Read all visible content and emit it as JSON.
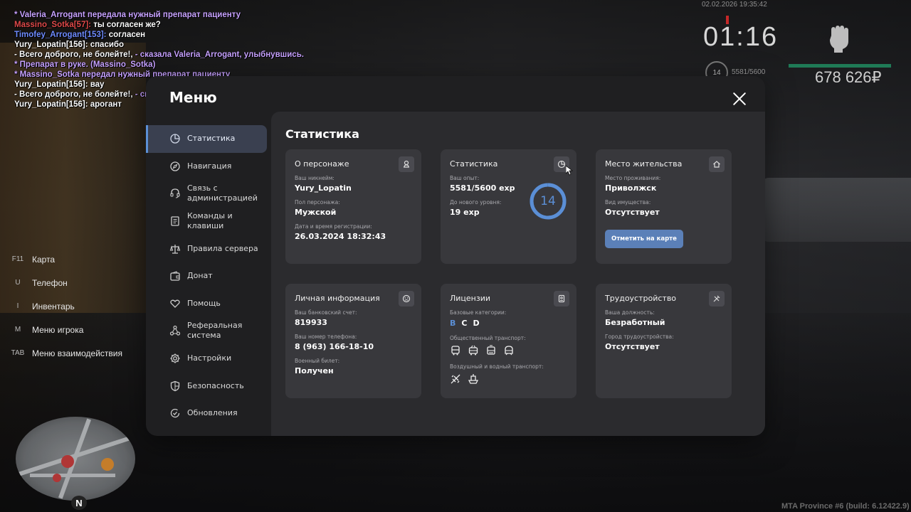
{
  "chat": [
    [
      {
        "t": " * Valeria_Arrogant передала нужный препарат пациенту",
        "c": "c-purple"
      }
    ],
    [
      {
        "t": "Massino_Sotka[57]: ",
        "c": "c-red"
      },
      {
        "t": "ты согласен же?",
        "c": "c-white"
      }
    ],
    [
      {
        "t": "Timofey_Arrogant[153]: ",
        "c": "c-blue"
      },
      {
        "t": "согласен",
        "c": "c-white"
      }
    ],
    [
      {
        "t": "Yury_Lopatin[156]: спасибо",
        "c": "c-white"
      }
    ],
    [
      {
        "t": "- Всего доброго, не болейте!, ",
        "c": "c-white"
      },
      {
        "t": "- сказала Valeria_Arrogant, улыбнувшись.",
        "c": "c-purple"
      }
    ],
    [
      {
        "t": " * Препарат в руке. (Massino_Sotka)",
        "c": "c-purple"
      }
    ],
    [
      {
        "t": " * Massino_Sotka передал нужный препарат пациенту",
        "c": "c-purple"
      }
    ],
    [
      {
        "t": "Yury_Lopatin[156]: вау",
        "c": "c-white"
      }
    ],
    [
      {
        "t": "- Всего доброго, не болейте!, ",
        "c": "c-white"
      },
      {
        "t": "- сказал Massino_Sotka, улыбнувшись.",
        "c": "c-purple"
      }
    ],
    [
      {
        "t": "Yury_Lopatin[156]: арогант",
        "c": "c-white"
      }
    ]
  ],
  "hud": {
    "date": "02.02.2026 19:35:42",
    "time": "01:16",
    "level": "14",
    "exp": "5581/5600",
    "money": "678 626₽"
  },
  "hints": [
    {
      "key": "F11",
      "label": "Карта"
    },
    {
      "key": "U",
      "label": "Телефон"
    },
    {
      "key": "I",
      "label": "Инвентарь"
    },
    {
      "key": "M",
      "label": "Меню игрока"
    },
    {
      "key": "TAB",
      "label": "Меню взаимодействия"
    }
  ],
  "build": "MTA Province #6 (build: 6.12422.9)",
  "menu": {
    "title": "Меню",
    "sidebar": [
      {
        "label": "Статистика",
        "icon": "pie-chart-icon",
        "active": true
      },
      {
        "label": "Навигация",
        "icon": "compass-icon"
      },
      {
        "label": "Связь с администрацией",
        "icon": "headset-icon"
      },
      {
        "label": "Команды и клавиши",
        "icon": "document-icon"
      },
      {
        "label": "Правила сервера",
        "icon": "scales-icon"
      },
      {
        "label": "Донат",
        "icon": "wallet-icon"
      },
      {
        "label": "Помощь",
        "icon": "heart-hand-icon"
      },
      {
        "label": "Реферальная система",
        "icon": "network-icon"
      },
      {
        "label": "Настройки",
        "icon": "gear-icon"
      },
      {
        "label": "Безопасность",
        "icon": "shield-icon"
      },
      {
        "label": "Обновления",
        "icon": "refresh-check-icon"
      }
    ],
    "content_title": "Статистика",
    "cards": {
      "character": {
        "title": "О персонаже",
        "nickname_label": "Ваш никнейм:",
        "nickname": "Yury_Lopatin",
        "gender_label": "Пол персонажа:",
        "gender": "Мужской",
        "reg_label": "Дата и время регистрации:",
        "reg": "26.03.2024 18:32:43"
      },
      "stats": {
        "title": "Статистика",
        "exp_label": "Ваш опыт:",
        "exp": "5581/5600 exp",
        "next_label": "До нового уровня:",
        "next": "19 exp",
        "level": "14",
        "level_progress": 0.9966
      },
      "residence": {
        "title": "Место жительства",
        "place_label": "Место проживания:",
        "place": "Приволжск",
        "property_label": "Вид имущества:",
        "property": "Отсутствует",
        "button": "Отметить на карте"
      },
      "personal": {
        "title": "Личная информация",
        "bank_label": "Ваш банковский счет:",
        "bank": "819933",
        "phone_label": "Ваш номер телефона:",
        "phone": "8 (963) 166-18-10",
        "military_label": "Военный билет:",
        "military": "Получен"
      },
      "licenses": {
        "title": "Лицензии",
        "base_label": "Базовые категории:",
        "base": [
          {
            "c": "B",
            "active": true
          },
          {
            "c": "C"
          },
          {
            "c": "D"
          }
        ],
        "public_label": "Общественный транспорт:",
        "public_icons": [
          "bus-icon",
          "trolleybus-icon",
          "tram-icon",
          "metro-icon"
        ],
        "airwater_label": "Воздушный и водный транспорт:",
        "airwater_icons": [
          "plane-icon",
          "boat-icon"
        ]
      },
      "job": {
        "title": "Трудоустройство",
        "position_label": "Ваша должность:",
        "position": "Безработный",
        "city_label": "Город трудоустройства:",
        "city": "Отсутствует"
      }
    }
  }
}
